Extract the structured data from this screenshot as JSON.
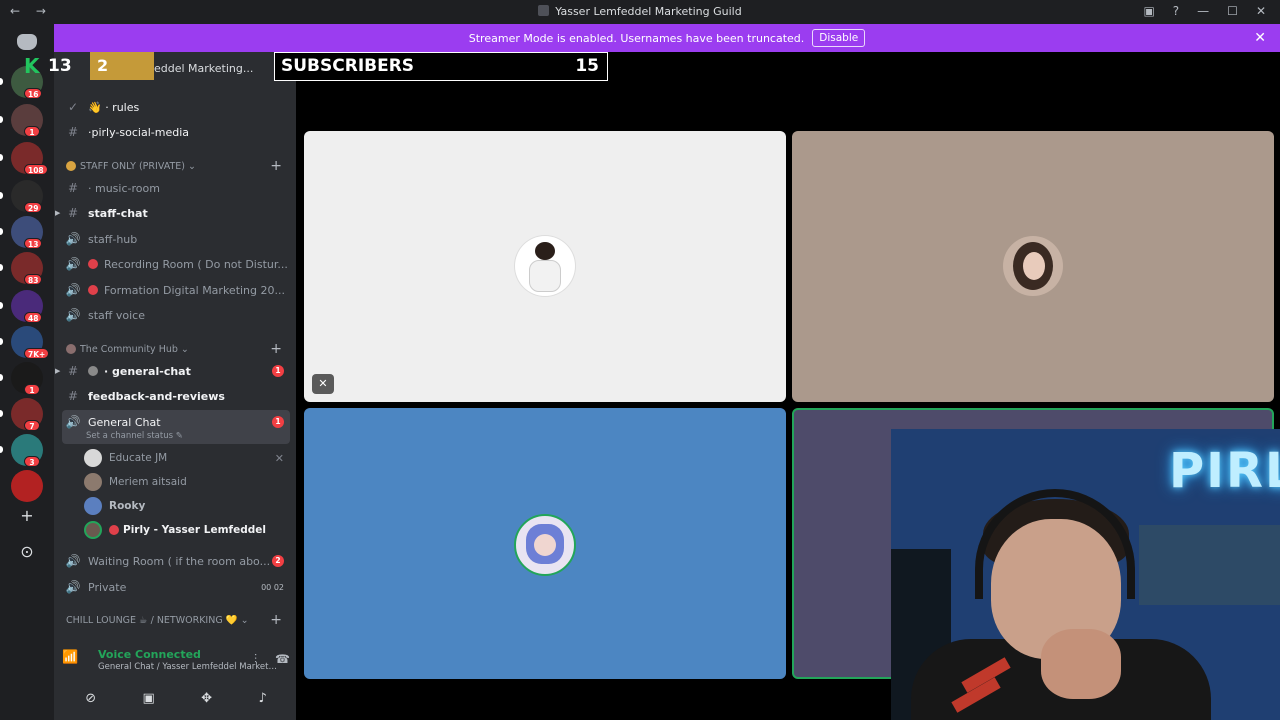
{
  "window": {
    "title": "Yasser Lemfeddel Marketing Guild",
    "nav_back": "←",
    "nav_forward": "→",
    "inbox_icon": "inbox-icon",
    "help_icon": "help-icon",
    "minimize": "—",
    "maximize": "☐",
    "close": "✕"
  },
  "banner": {
    "text": "Streamer Mode is enabled. Usernames have been truncated.",
    "button": "Disable",
    "close": "✕",
    "color": "#9b3df0"
  },
  "overlay": {
    "k_logo": "K",
    "count_left": "13",
    "count_gold": "2",
    "server_name": "eddel Marketing...",
    "label": "SUBSCRIBERS",
    "count": "15"
  },
  "rail": {
    "badges": [
      "16",
      "1",
      "108",
      "29",
      "13",
      "83",
      "48",
      "7K+",
      "1",
      "7",
      "3"
    ]
  },
  "sidebar": {
    "channels_top": [
      {
        "icon": "✓",
        "label": "👋 · rules"
      },
      {
        "icon": "#",
        "label": "·pirly-social-media"
      }
    ],
    "cat_staff": "STAFF ONLY (PRIVATE) ⌄",
    "staff_channels": [
      {
        "icon": "#",
        "label": "· music-room"
      },
      {
        "icon": "#",
        "label": "staff-chat"
      },
      {
        "icon": "🔊",
        "label": "staff-hub"
      },
      {
        "icon": "🔊",
        "label": "Recording Room ( Do not Distur..."
      },
      {
        "icon": "🔊",
        "label": "Formation Digital Marketing 20..."
      },
      {
        "icon": "🔊",
        "label": "staff voice"
      }
    ],
    "cat_community": "The Community Hub ⌄",
    "community_channels": [
      {
        "icon": "#",
        "label": "· general-chat",
        "mention": "1"
      },
      {
        "icon": "#",
        "label": "feedback-and-reviews"
      }
    ],
    "active_channel": {
      "label": "General Chat",
      "status": "Set a channel status ✎",
      "mention": "1"
    },
    "users": [
      {
        "name": "Educate JM"
      },
      {
        "name": "Meriem aitsaid"
      },
      {
        "name": "Rooky"
      },
      {
        "name": "Pirly - Yasser Lemfeddel"
      }
    ],
    "more_channels": [
      {
        "icon": "🔊",
        "label": "Waiting Room ( if the room abo...",
        "mention": "2"
      },
      {
        "icon": "🔊",
        "label": "Private",
        "extra": "00  02"
      }
    ],
    "cat_chill": "CHILL LOUNGE ☕ / NETWORKING 💛 ⌄"
  },
  "voice": {
    "title": "Voice Connected",
    "subtitle": "General Chat / Yasser Lemfeddel Marketing ..."
  },
  "colors": {
    "sidebar": "#2b2d31",
    "rail": "#1e1f22",
    "green": "#23a55a"
  }
}
